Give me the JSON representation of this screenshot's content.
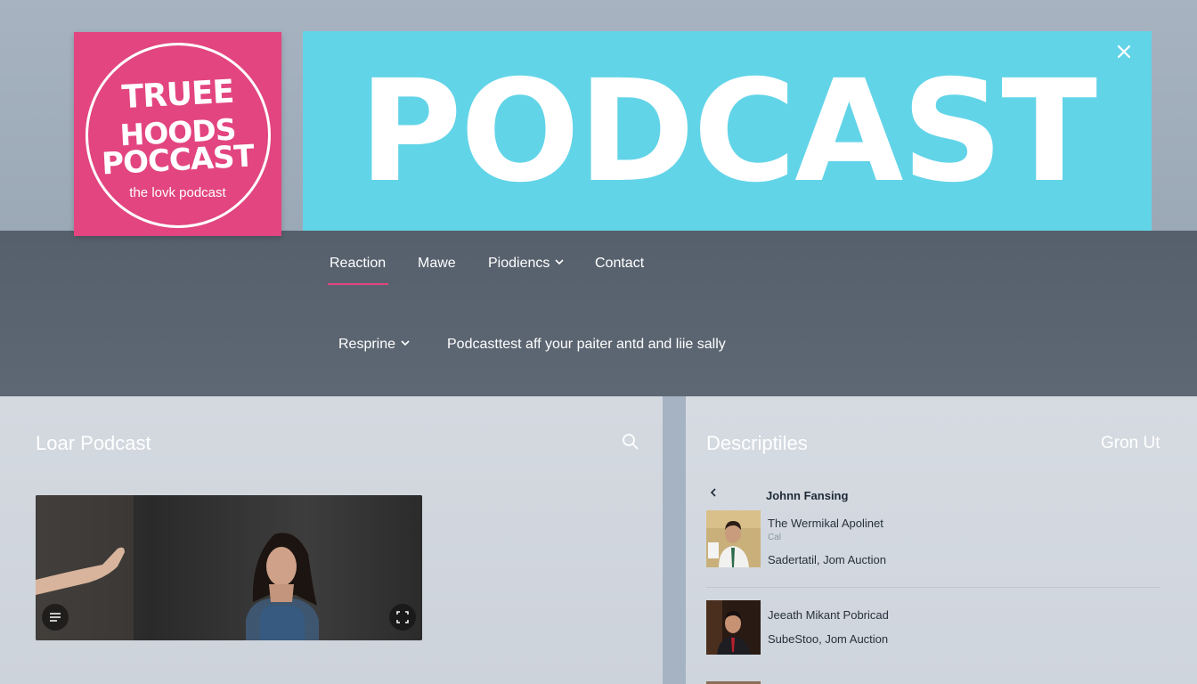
{
  "colors": {
    "accent_pink": "#e2457f",
    "banner_cyan": "#62d4e8",
    "nav_slate": "#5a6470"
  },
  "header": {
    "logo_lines": [
      "TRUEE",
      "HOODS",
      "POCCAST"
    ],
    "logo_tagline": "the lovk podcast",
    "banner_title": "PODCAST",
    "close_icon": "close-icon"
  },
  "nav": {
    "items": [
      {
        "label": "Reaction",
        "active": true
      },
      {
        "label": "Mawe",
        "active": false
      },
      {
        "label": "Piodiencs",
        "active": false,
        "has_dropdown": true
      },
      {
        "label": "Contact",
        "active": false
      }
    ],
    "sub": {
      "dropdown_label": "Resprine",
      "tagline": "Podcasttest aff your paiter antd and liie sally"
    }
  },
  "left_panel": {
    "title": "Loar Podcast",
    "search_icon": "search-icon",
    "video": {
      "left_control_icon": "playlist-icon",
      "right_control_icon": "fullscreen-icon"
    }
  },
  "right_panel": {
    "title": "Descriptiles",
    "group_link": "Gron Ut",
    "list_header": "Johnn Fansing",
    "episodes": [
      {
        "title": "The Wermikal Apolinet",
        "extra": "Cal",
        "subtitle": "Sadertatil, Jom Auction"
      },
      {
        "title": "Jeeath Mikant Pobricad",
        "subtitle": "SubeStoo, Jom Auction"
      }
    ]
  }
}
